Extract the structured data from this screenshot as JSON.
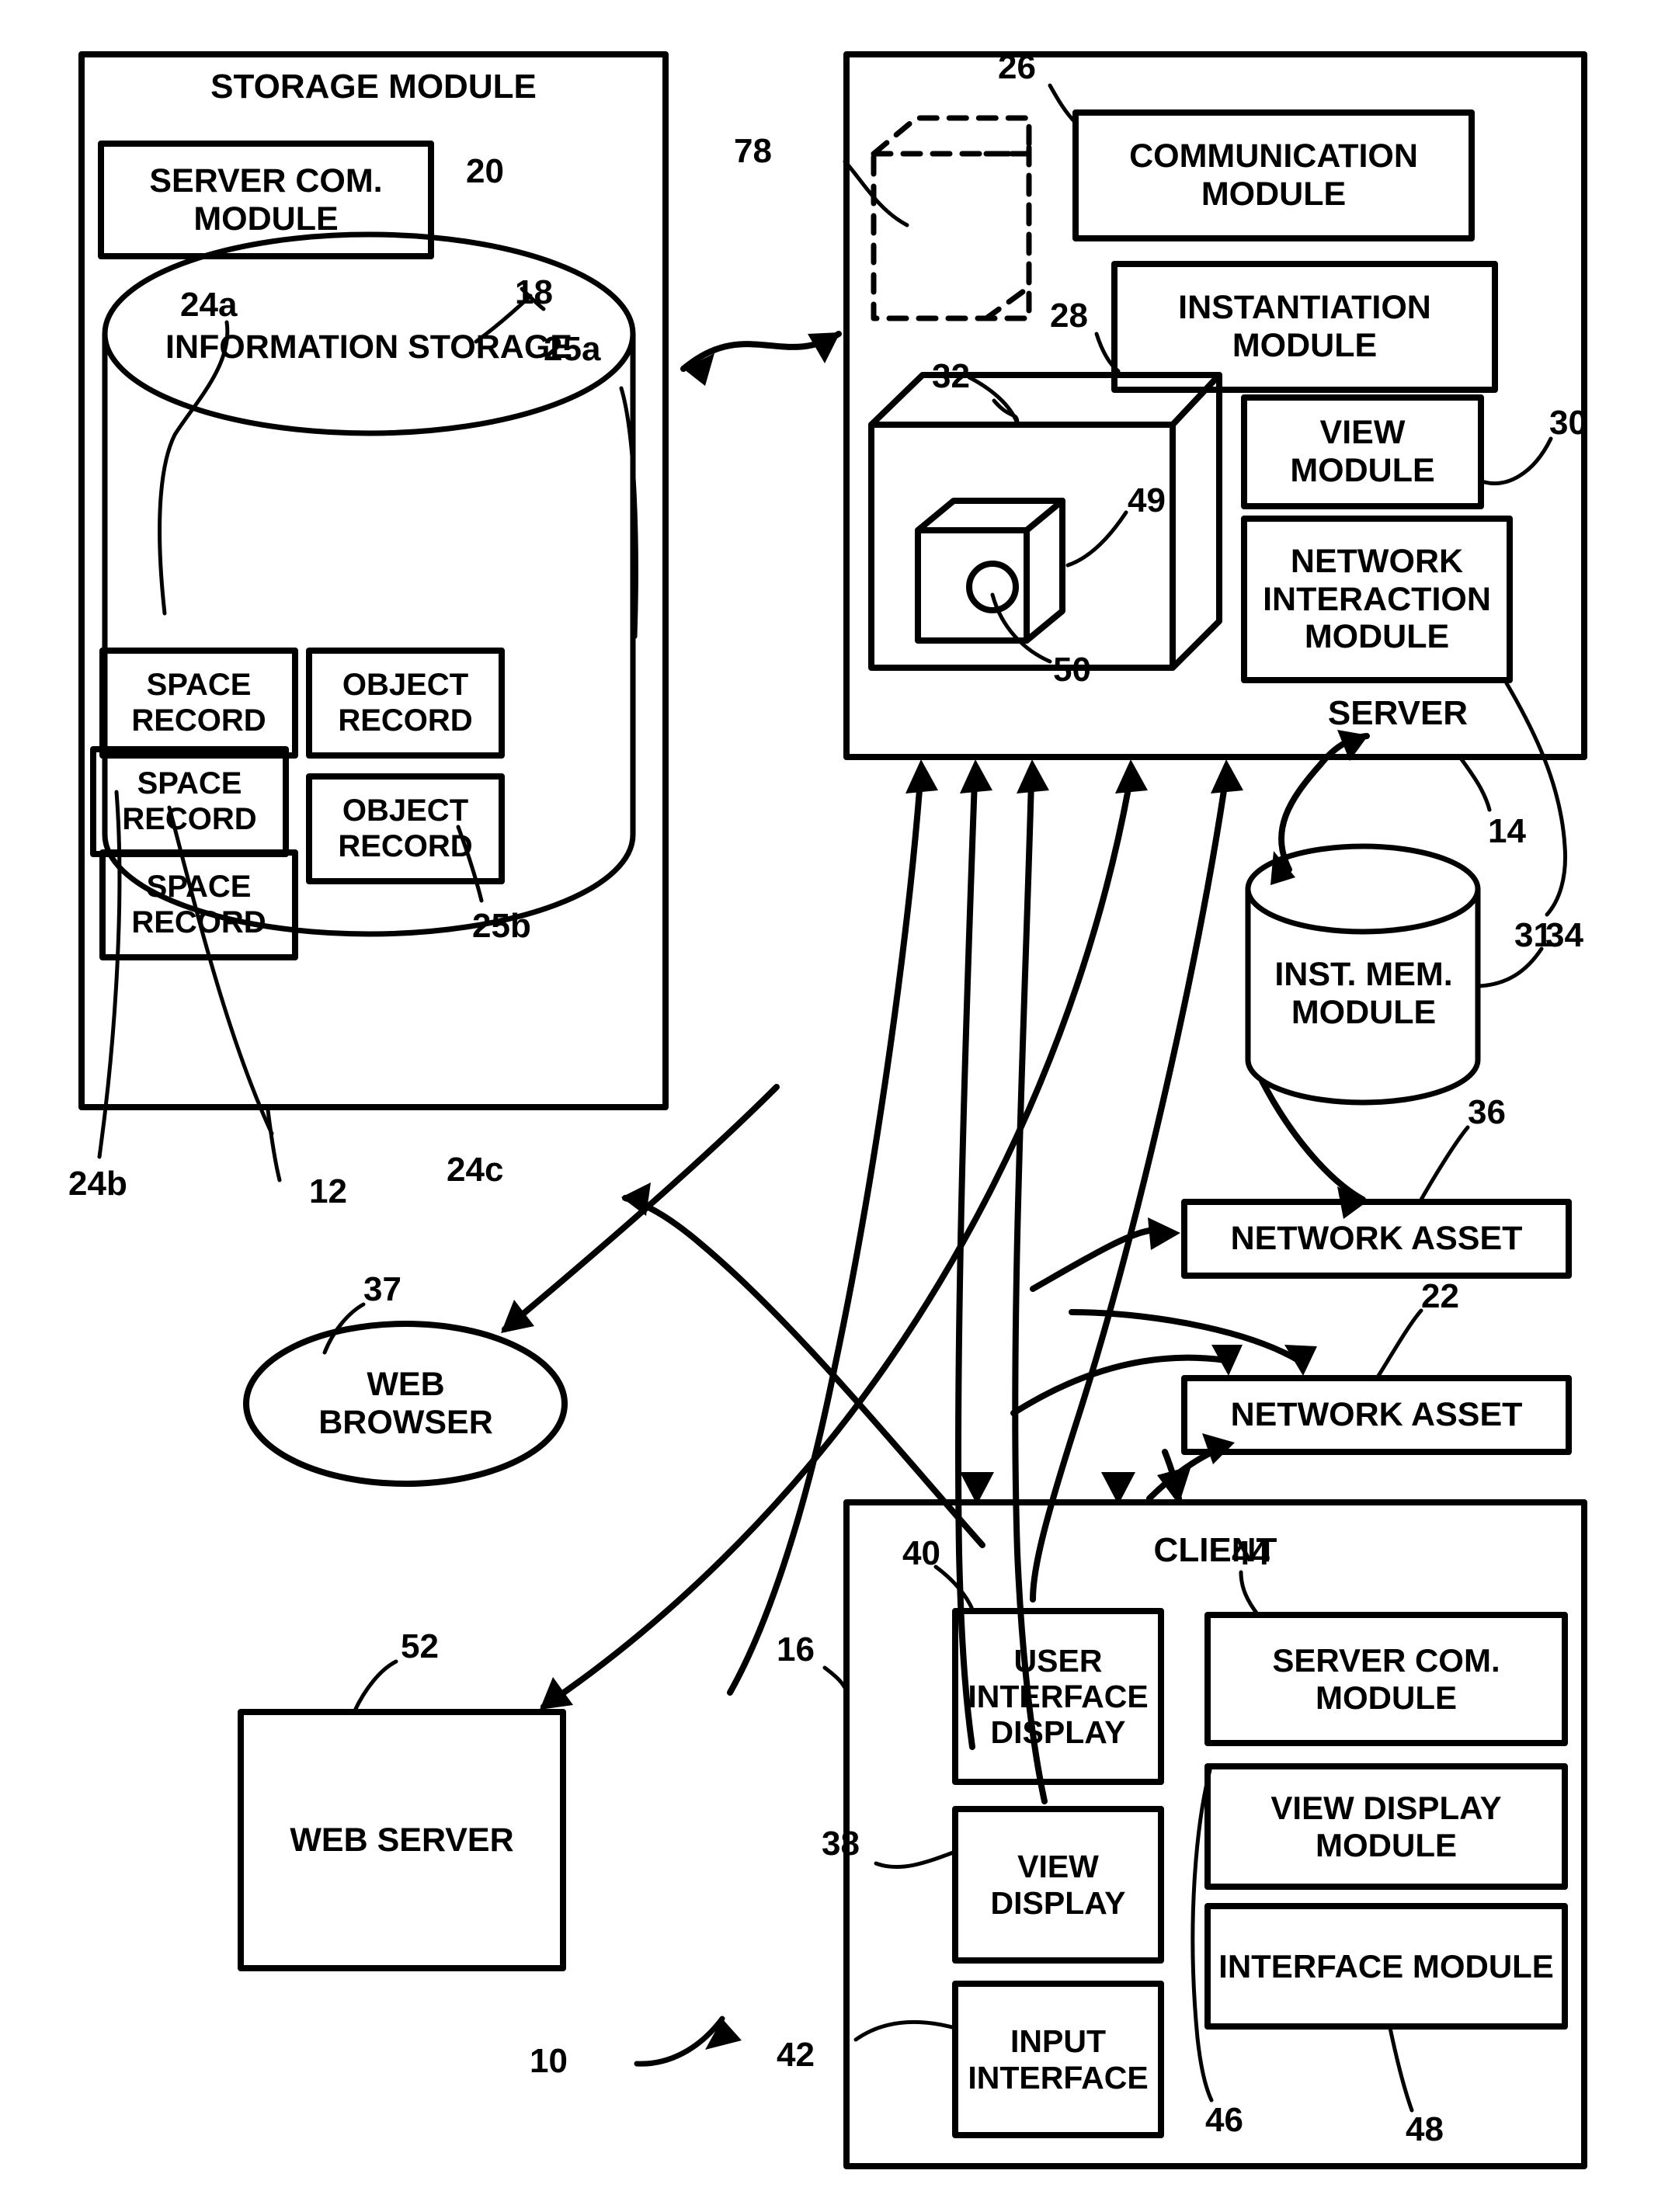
{
  "figure": {
    "type": "patent-block-diagram",
    "overall_ref": "10"
  },
  "storage_module": {
    "title": "STORAGE MODULE",
    "ref": "12",
    "server_com_module": {
      "label": "SERVER COM. MODULE",
      "ref": "20"
    },
    "information_storage": {
      "label": "INFORMATION STORAGE",
      "ref": "18"
    },
    "records": [
      {
        "label": "SPACE RECORD",
        "ref": "24a"
      },
      {
        "label": "OBJECT RECORD",
        "ref": "25a"
      },
      {
        "label": "SPACE RECORD",
        "ref": "24b"
      },
      {
        "label": "OBJECT RECORD",
        "ref": "25b"
      },
      {
        "label": "SPACE RECORD",
        "ref": "24c"
      }
    ]
  },
  "server": {
    "title": "SERVER",
    "ref": "14",
    "ref_secondary": "31",
    "dashed_object": {
      "ref": "78"
    },
    "cube": {
      "ref": "32"
    },
    "inner_cube": {
      "ref": "49"
    },
    "inner_circle": {
      "ref": "50"
    },
    "modules": [
      {
        "label": "COMMUNICATION MODULE",
        "ref": "26"
      },
      {
        "label": "INSTANTIATION MODULE",
        "ref": "28"
      },
      {
        "label": "VIEW MODULE",
        "ref": "30"
      },
      {
        "label": "NETWORK INTERACTION MODULE",
        "ref": ""
      }
    ]
  },
  "inst_mem_module": {
    "label": "INST. MEM. MODULE",
    "ref": "34"
  },
  "network_assets": [
    {
      "label": "NETWORK ASSET",
      "ref": "36"
    },
    {
      "label": "NETWORK ASSET",
      "ref": "22"
    }
  ],
  "web_browser": {
    "label": "WEB BROWSER",
    "ref": "37"
  },
  "web_server": {
    "label": "WEB SERVER",
    "ref": "52"
  },
  "client": {
    "title": "CLIENT",
    "ref": "16",
    "left_column": [
      {
        "label": "USER INTERFACE DISPLAY",
        "ref": "40"
      },
      {
        "label": "VIEW DISPLAY",
        "ref": "38"
      },
      {
        "label": "INPUT INTERFACE",
        "ref": "42"
      }
    ],
    "right_column": [
      {
        "label": "SERVER COM. MODULE",
        "ref": "44"
      },
      {
        "label": "VIEW DISPLAY MODULE",
        "ref": "46"
      },
      {
        "label": "INTERFACE MODULE",
        "ref": "48"
      }
    ]
  },
  "colors": {
    "ink": "#000000",
    "paper": "#ffffff"
  }
}
